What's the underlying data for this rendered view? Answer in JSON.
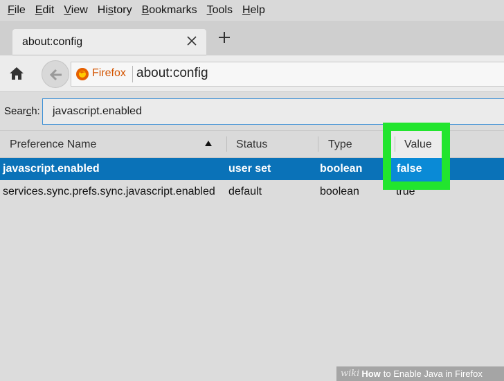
{
  "menu": [
    {
      "acc": "F",
      "rest": "ile"
    },
    {
      "acc": "E",
      "rest": "dit"
    },
    {
      "acc": "V",
      "rest": "iew"
    },
    {
      "pre": "Hi",
      "acc": "s",
      "rest": "tory"
    },
    {
      "acc": "B",
      "rest": "ookmarks"
    },
    {
      "acc": "T",
      "rest": "ools"
    },
    {
      "acc": "H",
      "rest": "elp"
    }
  ],
  "tab": {
    "title": "about:config"
  },
  "nav": {
    "identity_label": "Firefox",
    "url": "about:config"
  },
  "search": {
    "label_pre": "Sear",
    "label_acc": "c",
    "label_post": "h:",
    "value": "javascript.enabled"
  },
  "table": {
    "columns": [
      "Preference Name",
      "Status",
      "Type",
      "Value"
    ],
    "rows": [
      {
        "name": "javascript.enabled",
        "status": "user set",
        "type": "boolean",
        "value": "false",
        "selected": true
      },
      {
        "name": "services.sync.prefs.sync.javascript.enabled",
        "status": "default",
        "type": "boolean",
        "value": "true",
        "selected": false
      }
    ]
  },
  "watermark": {
    "wiki": "wiki",
    "how": "How",
    "rest": "to Enable Java in Firefox"
  },
  "colors": {
    "selection": "#0a72b8",
    "highlight": "#22e52e",
    "firefox_orange": "#d35400"
  }
}
